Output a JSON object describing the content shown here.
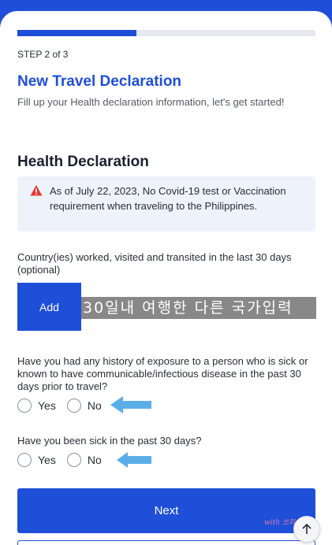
{
  "progress": {
    "value": 0.4
  },
  "header": {
    "step_label": "STEP 2 of 3",
    "title": "New Travel Declaration",
    "subtitle": "Fill up your Health declaration information, let's get started!"
  },
  "section": {
    "title": "Health Declaration"
  },
  "alert": {
    "icon": "warning-triangle-icon",
    "color": "#e53935",
    "text": "As of July 22, 2023, No Covid-19 test or Vaccination requirement when traveling to the Philippines."
  },
  "countries": {
    "label": "Country(ies) worked, visited and transited in the last 30 days (optional)",
    "add_label": "Add",
    "overlay_caption": "30일내 여행한 다른 국가입력"
  },
  "questions": [
    {
      "text": "Have you had any history of exposure to a person who is sick or known to have communicable/infectious disease in the past 30 days prior to travel?",
      "options": [
        "Yes",
        "No"
      ]
    },
    {
      "text": "Have you been sick in the past 30 days?",
      "options": [
        "Yes",
        "No"
      ]
    }
  ],
  "footer": {
    "next_label": "Next",
    "watermark": "with 쏘피...",
    "scroll_top_icon": "arrow-up-icon"
  },
  "colors": {
    "primary": "#1f4fd8",
    "arrow": "#5aaee8"
  }
}
